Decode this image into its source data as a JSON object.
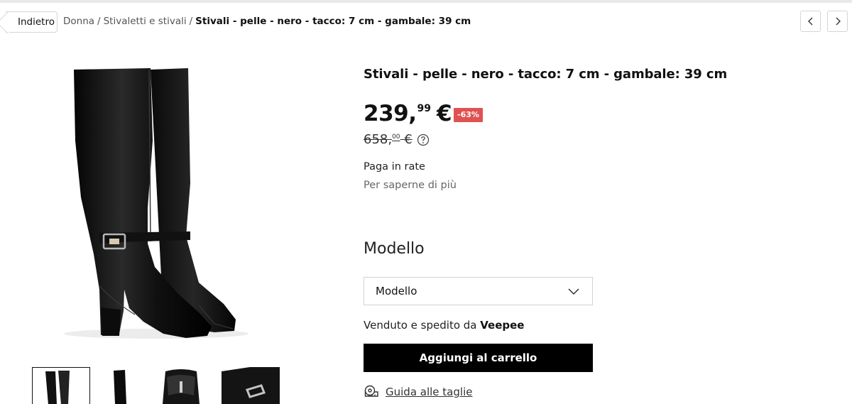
{
  "breadcrumb": {
    "back_label": "Indietro",
    "items": [
      "Donna",
      "Stivaletti e stivali"
    ],
    "separator": "/",
    "current": "Stivali - pelle - nero - tacco: 7 cm - gambale: 39 cm"
  },
  "product": {
    "title": "Stivali - pelle - nero - tacco: 7 cm - gambale: 39 cm",
    "price_int": "239,",
    "price_dec": "99",
    "currency": "€",
    "discount": "-63%",
    "old_price_int": "658,",
    "old_price_dec": "00",
    "installments_label": "Paga in rate",
    "learn_more_label": "Per saperne di più",
    "model_heading": "Modello",
    "model_select_value": "Modello",
    "sold_by_prefix": "Venduto e spedito da",
    "sold_by_brand": "Veepee",
    "add_to_cart_label": "Aggiungi al carrello",
    "size_guide_label": "Guida alle taglie"
  },
  "colors": {
    "discount_badge": "#e05151",
    "button_bg": "#000000"
  },
  "icons": {
    "prev": "chevron-left-icon",
    "next": "chevron-right-icon",
    "help": "question-circle-icon",
    "select": "chevron-down-icon",
    "size_guide": "measuring-tape-icon"
  }
}
